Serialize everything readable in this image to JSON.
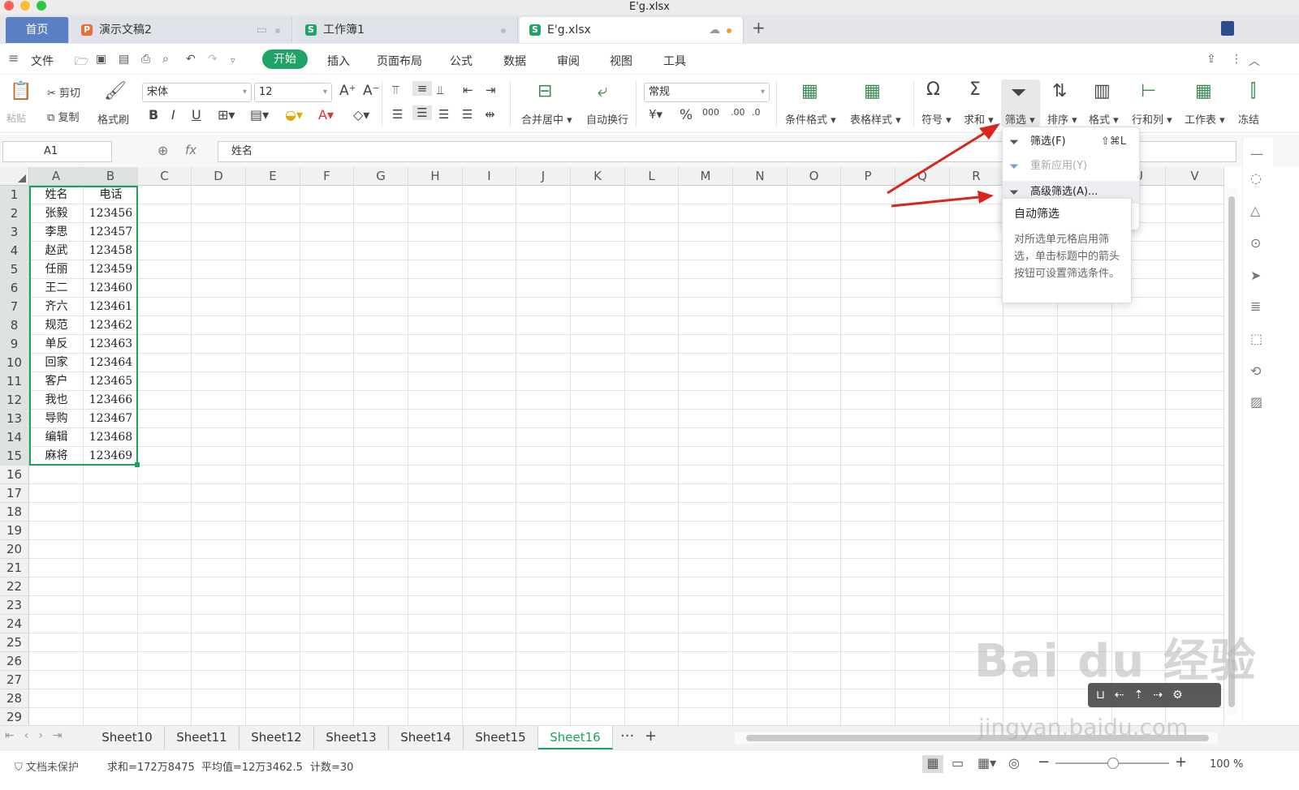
{
  "window": {
    "title": "E'g.xlsx"
  },
  "tabs": [
    {
      "label": "首页"
    },
    {
      "label": "演示文稿2"
    },
    {
      "label": "工作簿1"
    },
    {
      "label": "E'g.xlsx"
    }
  ],
  "menubar": {
    "file": "文件",
    "items": [
      "开始",
      "插入",
      "页面布局",
      "公式",
      "数据",
      "审阅",
      "视图",
      "工具"
    ]
  },
  "toolbar": {
    "paste": "粘贴",
    "cut": "剪切",
    "copy": "复制",
    "format_painter": "格式刷",
    "font": "宋体",
    "font_size": "12",
    "merge": "合并居中",
    "wrap": "自动换行",
    "number_format": "常规",
    "cond_format": "条件格式",
    "table_style": "表格样式",
    "symbol": "符号",
    "sum": "求和",
    "filter": "筛选",
    "sort": "排序",
    "format": "格式",
    "rowcol": "行和列",
    "sheet": "工作表",
    "freeze": "冻结"
  },
  "formula": {
    "cell_ref": "A1",
    "fx": "fx",
    "value": "姓名"
  },
  "columns": [
    "A",
    "B",
    "C",
    "D",
    "E",
    "F",
    "G",
    "H",
    "I",
    "J",
    "K",
    "L",
    "M",
    "N",
    "O",
    "P",
    "Q",
    "R",
    "S",
    "T",
    "U",
    "V"
  ],
  "rows": [
    "1",
    "2",
    "3",
    "4",
    "5",
    "6",
    "7",
    "8",
    "9",
    "10",
    "11",
    "12",
    "13",
    "14",
    "15",
    "16",
    "17",
    "18",
    "19",
    "20",
    "21",
    "22",
    "23",
    "24",
    "25",
    "26",
    "27",
    "28",
    "29"
  ],
  "table": [
    [
      "姓名",
      "电话"
    ],
    [
      "张毅",
      "123456"
    ],
    [
      "李思",
      "123457"
    ],
    [
      "赵武",
      "123458"
    ],
    [
      "任丽",
      "123459"
    ],
    [
      "王二",
      "123460"
    ],
    [
      "齐六",
      "123461"
    ],
    [
      "规范",
      "123462"
    ],
    [
      "单反",
      "123463"
    ],
    [
      "回家",
      "123464"
    ],
    [
      "客户",
      "123465"
    ],
    [
      "我也",
      "123466"
    ],
    [
      "导购",
      "123467"
    ],
    [
      "编辑",
      "123468"
    ],
    [
      "麻将",
      "123469"
    ]
  ],
  "filter_menu": {
    "items": [
      {
        "label": "筛选(F)",
        "shortcut": "⇧⌘L"
      },
      {
        "label": "重新应用(Y)",
        "shortcut": ""
      },
      {
        "label": "高级筛选(A)...",
        "shortcut": ""
      }
    ]
  },
  "tooltip": {
    "title": "自动筛选",
    "body": "对所选单元格启用筛选，单击标题中的箭头按钮可设置筛选条件。"
  },
  "sheets": [
    "Sheet10",
    "Sheet11",
    "Sheet12",
    "Sheet13",
    "Sheet14",
    "Sheet15",
    "Sheet16"
  ],
  "active_sheet": "Sheet16",
  "status": {
    "protect": "文档未保护",
    "sum": "求和=172万8475",
    "avg": "平均值=12万3462.5",
    "count": "计数=30",
    "zoom": "100 %"
  },
  "watermark": {
    "brand": "Bai du 经验",
    "url": "jingyan.baidu.com"
  },
  "colors": {
    "accent": "#21a366",
    "arrow": "#d9261c",
    "selection": "#1aa35a"
  }
}
